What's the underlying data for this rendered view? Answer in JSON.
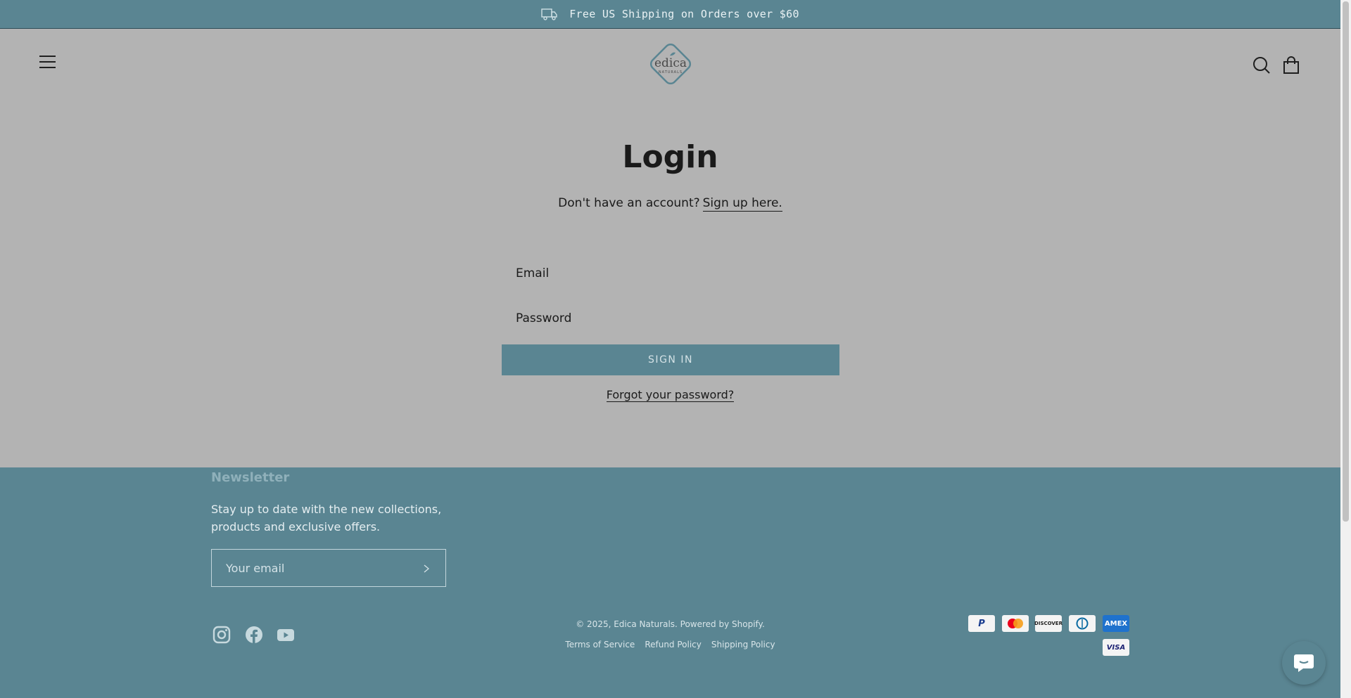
{
  "announcement": {
    "text": "Free US Shipping on Orders over $60",
    "icon": "truck-icon"
  },
  "header": {
    "logo_text": "edica",
    "logo_subtext": "NATURALS",
    "icons": [
      "menu-icon",
      "search-icon",
      "shopping-bag-icon"
    ]
  },
  "login": {
    "title": "Login",
    "no_account_text": "Don't have an account?",
    "signup_link": "Sign up here.",
    "email_placeholder": "Email",
    "password_placeholder": "Password",
    "signin_label": "SIGN IN",
    "forgot_link": "Forgot your password?"
  },
  "footer": {
    "newsletter_title": "Newsletter",
    "newsletter_text": "Stay up to date with the new collections, products and exclusive offers.",
    "email_placeholder": "Your email",
    "social": [
      "instagram-icon",
      "facebook-icon",
      "youtube-icon"
    ],
    "copyright": "© 2025, Edica Naturals. Powered by Shopify.",
    "policies": [
      "Terms of Service",
      "Refund Policy",
      "Shipping Policy"
    ],
    "payment_methods": [
      "PayPal",
      "Mastercard",
      "DISCOVER",
      "Diners Club",
      "AMEX",
      "VISA"
    ]
  },
  "colors": {
    "accent": "#5a8592",
    "background": "#b3b3b3",
    "text": "#1a1a1a"
  }
}
